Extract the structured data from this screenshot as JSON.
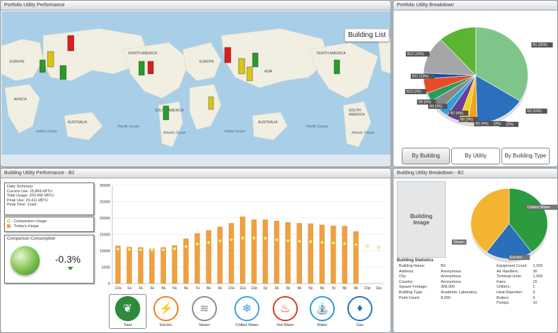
{
  "portfolio_performance": {
    "title": "Portfolio Utility Performance",
    "building_list_label": "Building List",
    "continents": [
      "EUROPE",
      "AFRICA",
      "AUSTRALIA",
      "NORTH AMERICA",
      "SOUTH AMERICA",
      "EUROPE",
      "ASIA",
      "AUSTRALIA",
      "NORTH AMERICA",
      "SOUTH AMERICA"
    ],
    "oceans": [
      "Indian Ocean",
      "Pacific Ocean",
      "Atlantic Ocean",
      "Indian Ocean",
      "Pacific Ocean",
      "Atlantic Ocean"
    ]
  },
  "portfolio_breakdown": {
    "title": "Portfolio Utility Breakdown",
    "tabs": [
      "By Building",
      "By Utility",
      "By Building Type"
    ],
    "selected_tab": "By Building",
    "chart_data": {
      "type": "pie",
      "labels": [
        "B1 (35%)",
        "B2 (16%)",
        "B3 (3%)",
        "B4 (3%)",
        "B5 (4%)",
        "B6 (3%)",
        "B7 (4%)",
        "B8 (3%)",
        "B9 (5%)",
        "B10 (2%)",
        "B11 (13%)",
        "B12 (12%)"
      ],
      "values": [
        35,
        16,
        3,
        3,
        4,
        3,
        4,
        3,
        5,
        2,
        13,
        12
      ],
      "colors": [
        "#7fc58a",
        "#2b6fbd",
        "#f0a024",
        "#f3d21c",
        "#6a3d9a",
        "#33a0d8",
        "#888888",
        "#2a9c5a",
        "#e74c28",
        "#1e4f9c",
        "#a4a6a8",
        "#5ab531"
      ]
    }
  },
  "building_performance": {
    "title": "Building Utility Performance - B2",
    "daily_summary": {
      "title": "Daily Summary",
      "rows": [
        "Current Use:  15,869 kBTU",
        "Total Usage:  333,492 kBTU",
        "Peak Use:      29,411 kBTU",
        "Peak Time:     11am"
      ]
    },
    "legend": [
      "- Comparison Usage",
      "- Today's Usage"
    ],
    "comparison": {
      "title": "Comparison Consumption",
      "value": "-0.3%"
    },
    "chart_data": {
      "type": "bar",
      "categories": [
        "12a",
        "1a",
        "2a",
        "3a",
        "4a",
        "5a",
        "6a",
        "7a",
        "8a",
        "9a",
        "10a",
        "11a",
        "12p",
        "1p",
        "2p",
        "3p",
        "4p",
        "5p",
        "6p",
        "7p",
        "8p",
        "9p",
        "10p",
        "11p"
      ],
      "series": [
        {
          "name": "Today's Usage",
          "values": [
            11500,
            11100,
            11000,
            10600,
            11000,
            11600,
            13700,
            15300,
            16200,
            17300,
            18400,
            20400,
            19500,
            19500,
            19100,
            18700,
            18400,
            18300,
            17900,
            17600,
            17500,
            15900,
            null,
            null
          ]
        },
        {
          "name": "Comparison Usage",
          "values": [
            10500,
            10400,
            10300,
            10200,
            10300,
            10600,
            11300,
            12100,
            12500,
            13000,
            13400,
            13900,
            13900,
            13800,
            13400,
            13100,
            12900,
            12800,
            12600,
            12400,
            12200,
            11900,
            11500,
            11100
          ]
        }
      ],
      "ylim": [
        0,
        30000
      ],
      "yticks": [
        "0",
        "5000",
        "10000",
        "15000",
        "20000",
        "25000",
        "30000"
      ]
    },
    "utilities": [
      {
        "label": "Total",
        "color": "#2d8a3e",
        "glyph": "❦"
      },
      {
        "label": "Electric",
        "color": "#ef7d1a",
        "glyph": "⚡"
      },
      {
        "label": "Steam",
        "color": "#8a8a8a",
        "glyph": "≋"
      },
      {
        "label": "Chilled Water",
        "color": "#34a3dc",
        "glyph": "❄"
      },
      {
        "label": "Hot Water",
        "color": "#d93a1f",
        "glyph": "♨"
      },
      {
        "label": "Water",
        "color": "#1d9fd6",
        "glyph": "⛲"
      },
      {
        "label": "Gas",
        "color": "#1f6fbf",
        "glyph": "♦"
      }
    ]
  },
  "building_breakdown": {
    "title": "Building Utility Breakdown - B2",
    "image_label_1": "Building",
    "image_label_2": "Image",
    "chart_data": {
      "type": "pie",
      "labels": [
        "Chilled Water",
        "Electric",
        "Steam"
      ],
      "values": [
        40,
        20,
        40
      ],
      "colors": [
        "#2c9a3e",
        "#2a6fba",
        "#f3b431"
      ]
    },
    "stats_title": "Building Statistics",
    "stats_left": [
      [
        "Building Name:",
        "B2"
      ],
      [
        "Address:",
        "Anonymous"
      ],
      [
        "City:",
        "Anonymous"
      ],
      [
        "Country:",
        "Anonymous"
      ],
      [
        "Square Footage:",
        "308,000"
      ],
      [
        "Building Type:",
        "Academic Laboratory"
      ],
      [
        "Point Count:",
        "8,000"
      ]
    ],
    "stats_right": [
      [
        "Equipment Count:",
        "1,200"
      ],
      [
        "Air Handlers:",
        "30"
      ],
      [
        "Terminal Units:",
        "1,000"
      ],
      [
        "Fans:",
        "15"
      ],
      [
        "Chillers:",
        "1"
      ],
      [
        "Heat Rejection:",
        "0"
      ],
      [
        "Boilers:",
        "0"
      ],
      [
        "Pumps:",
        "10"
      ]
    ]
  }
}
